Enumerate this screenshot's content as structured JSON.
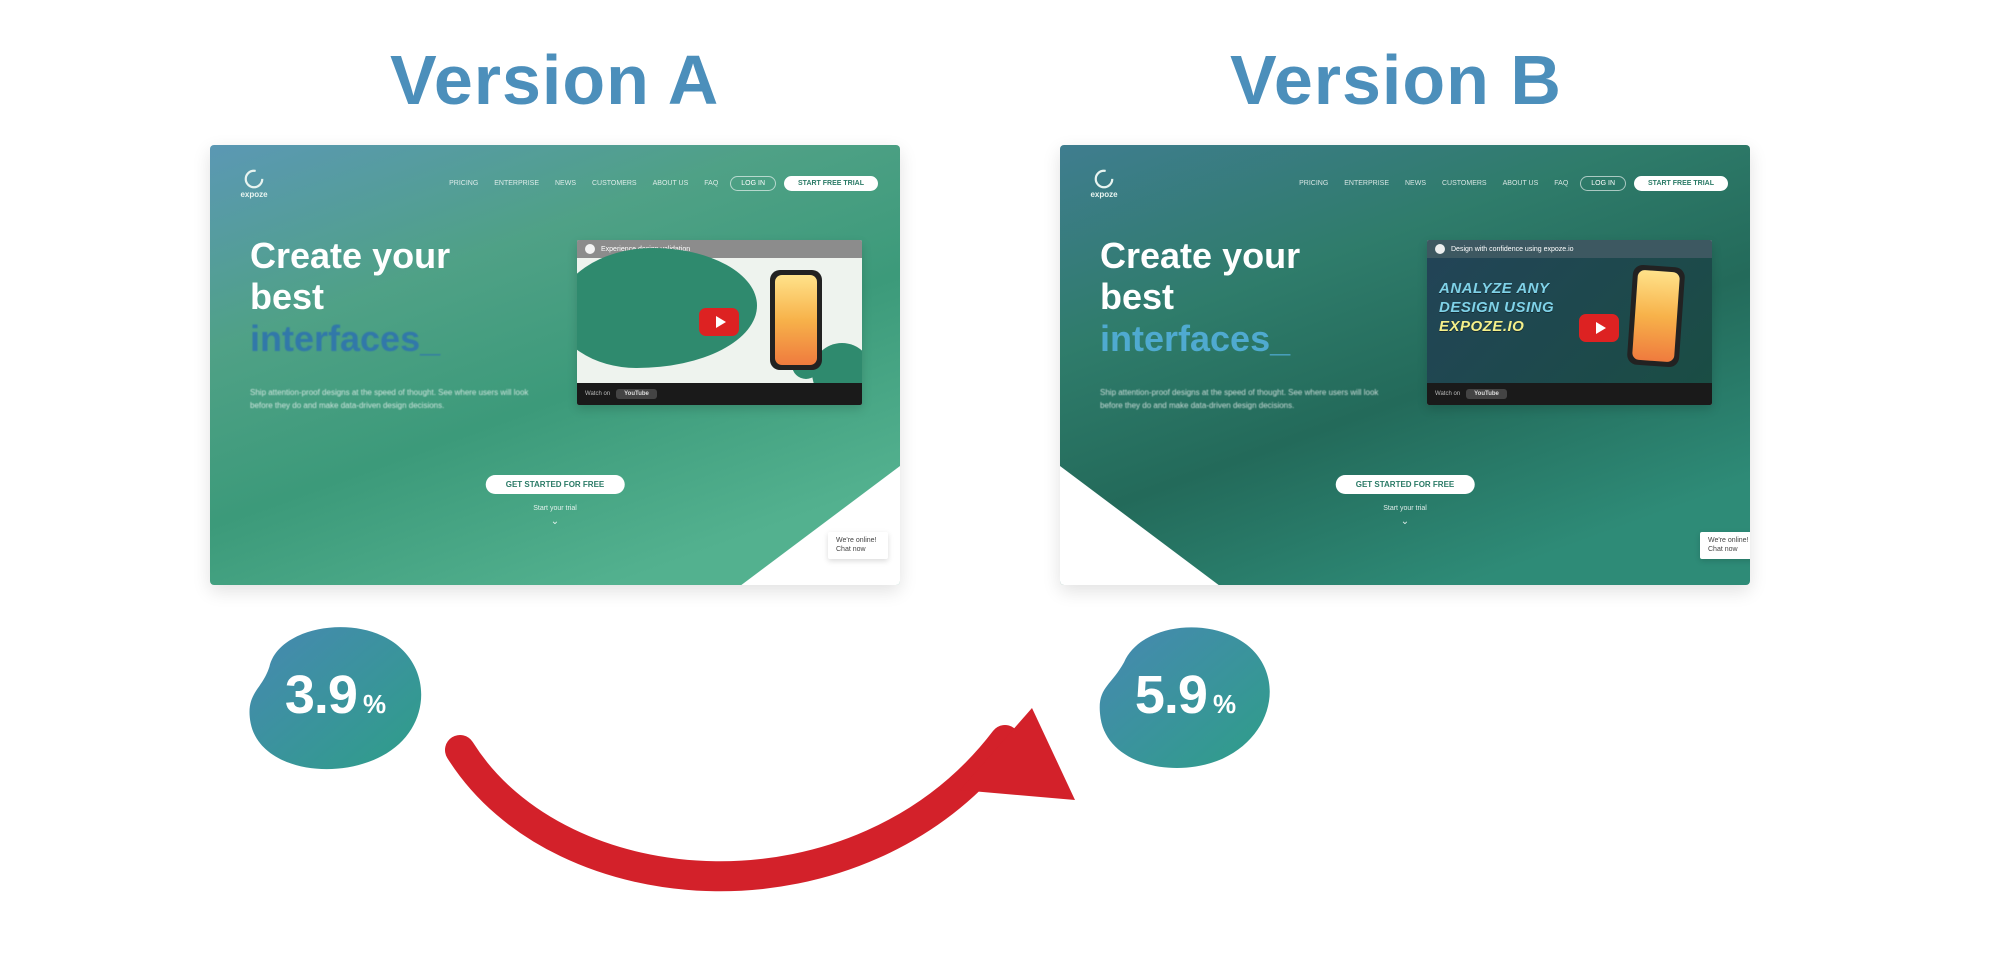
{
  "labels": {
    "a": "Version A",
    "b": "Version B"
  },
  "conversion": {
    "a": {
      "value": "3.9",
      "unit": "%"
    },
    "b": {
      "value": "5.9",
      "unit": "%"
    }
  },
  "brand": "expoze",
  "nav": {
    "items": [
      "PRICING",
      "ENTERPRISE",
      "NEWS",
      "CUSTOMERS",
      "ABOUT US",
      "FAQ"
    ],
    "login": "LOG IN",
    "cta": "START FREE TRIAL"
  },
  "hero": {
    "line1": "Create your",
    "line2": "best",
    "accent": "interfaces",
    "cursor": "_",
    "sub": "Ship attention-proof designs at the speed of thought. See where users will look before they do and make data-driven design decisions.",
    "cta": "GET STARTED FOR FREE",
    "trial": "Start your trial",
    "chev": "⌄"
  },
  "videoA": {
    "caption": "Experience design validation",
    "footer_watch": "Watch on",
    "footer_brand": "YouTube"
  },
  "videoB": {
    "caption": "Design with confidence using expoze.io",
    "line1": "ANALYZE ANY",
    "line2": "DESIGN USING",
    "line3": "EXPOZE.IO",
    "footer_watch": "Watch on",
    "footer_brand": "YouTube"
  },
  "chat": "We're online! Chat now",
  "colors": {
    "label": "#4c8fbb",
    "badge_from": "#4788b2",
    "badge_to": "#2e9e88",
    "arrow": "#d3212a"
  }
}
